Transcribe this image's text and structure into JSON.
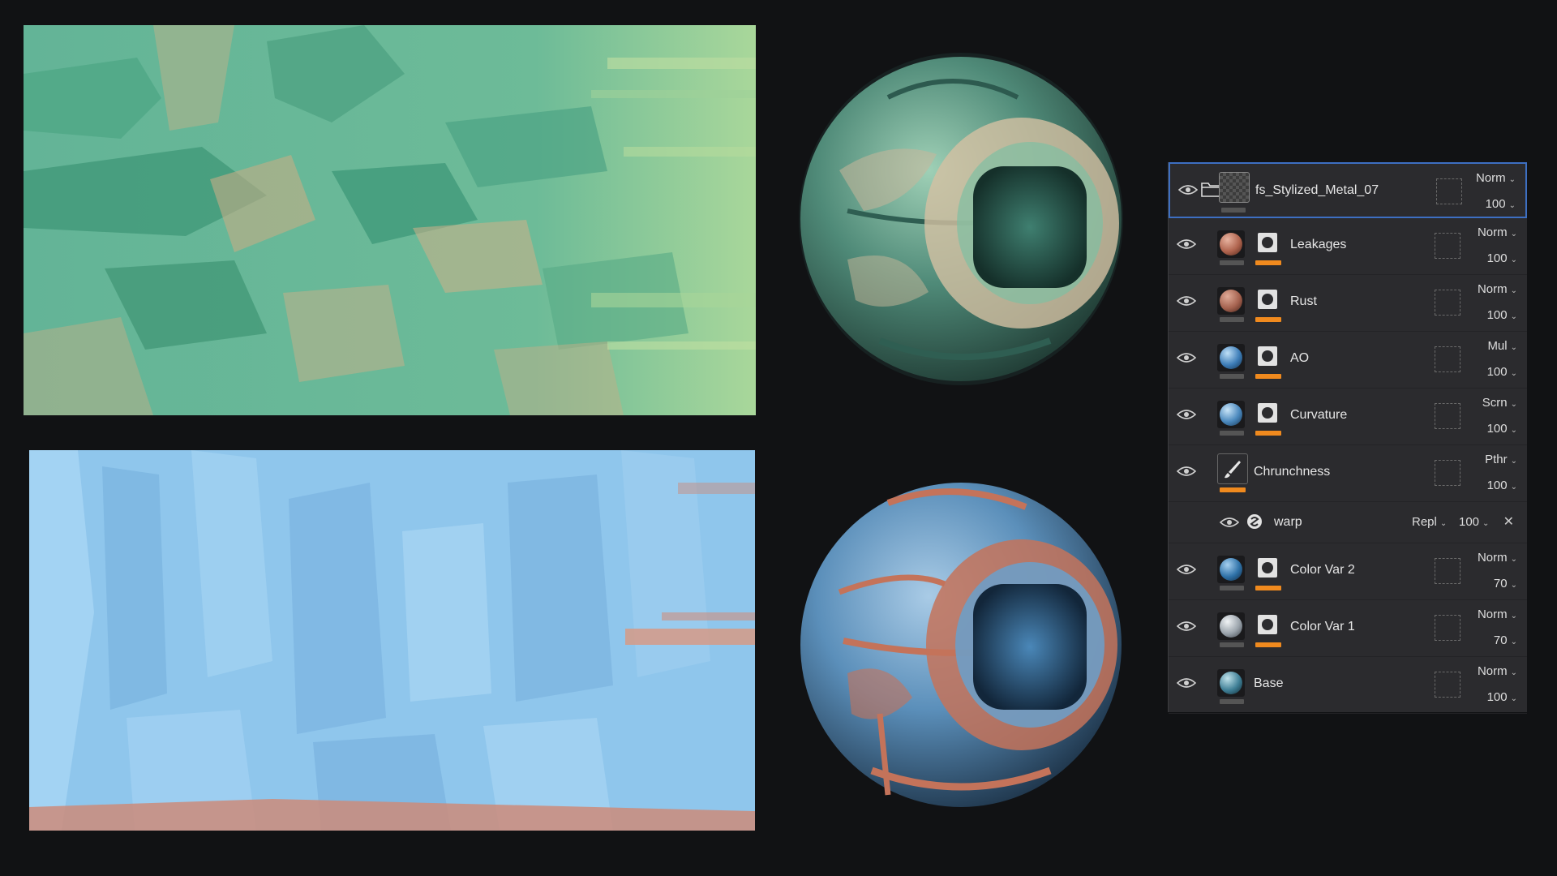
{
  "textures": {
    "top": {
      "name": "green-texture-preview",
      "base_color": "#5fb08f"
    },
    "bottom": {
      "name": "blue-texture-preview",
      "base_color": "#8fc8ee"
    }
  },
  "spheres": {
    "top": {
      "name": "green-metal-sphere",
      "base_color": "#4f8a78"
    },
    "bottom": {
      "name": "blue-metal-sphere",
      "base_color": "#5b8fba",
      "rust_color": "#c4735a"
    }
  },
  "layers": [
    {
      "kind": "group",
      "name": "fs_Stylized_Metal_07",
      "blend": "Norm",
      "opacity": "100"
    },
    {
      "kind": "fill",
      "name": "Leakages",
      "blend": "Norm",
      "opacity": "100",
      "ball_color": "#b0644e",
      "has_mask": true
    },
    {
      "kind": "fill",
      "name": "Rust",
      "blend": "Norm",
      "opacity": "100",
      "ball_color": "#a5624f",
      "has_mask": true
    },
    {
      "kind": "fill",
      "name": "AO",
      "blend": "Mul",
      "opacity": "100",
      "ball_color": "#3d7db8",
      "has_mask": true
    },
    {
      "kind": "fill",
      "name": "Curvature",
      "blend": "Scrn",
      "opacity": "100",
      "ball_color": "#4a88bd",
      "has_mask": true
    },
    {
      "kind": "paint",
      "name": "Chrunchness",
      "blend": "Pthr",
      "opacity": "100"
    },
    {
      "kind": "effect",
      "name": "warp",
      "blend": "Repl",
      "opacity": "100"
    },
    {
      "kind": "fill",
      "name": "Color Var 2",
      "blend": "Norm",
      "opacity": "70",
      "ball_color": "#2f72a8",
      "has_mask": true
    },
    {
      "kind": "fill",
      "name": "Color Var 1",
      "blend": "Norm",
      "opacity": "70",
      "ball_color": "#9aa3ab",
      "has_mask": true
    },
    {
      "kind": "fill",
      "name": "Base",
      "blend": "Norm",
      "opacity": "100",
      "ball_color": "#3f7f96",
      "has_mask": false
    }
  ],
  "colors": {
    "panel_bg": "#2b2b2e",
    "accent_orange": "#f08a1e",
    "selection_blue": "#3d6fc2"
  }
}
